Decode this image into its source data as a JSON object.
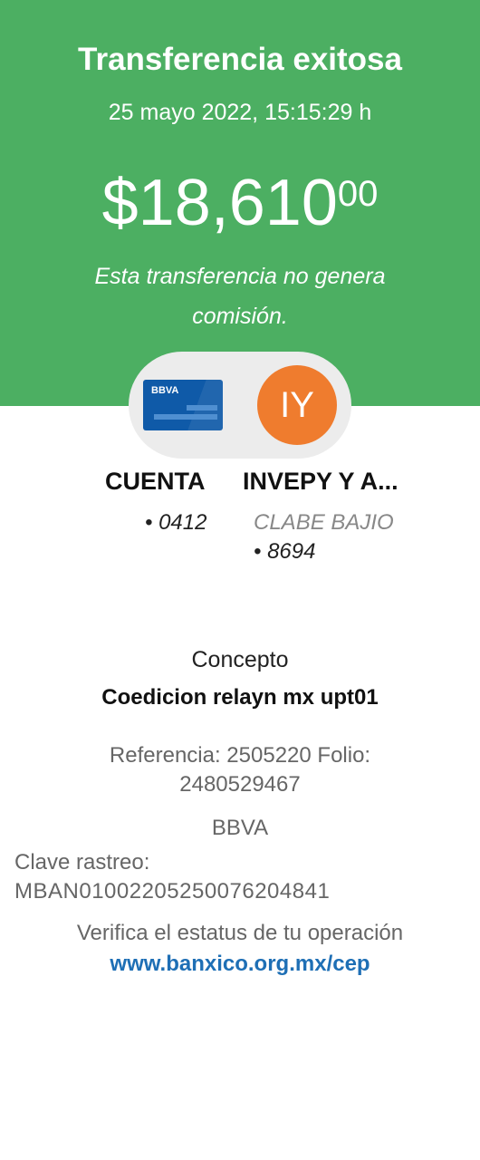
{
  "header": {
    "title": "Transferencia exitosa",
    "datetime": "25 mayo 2022, 15:15:29 h",
    "amount": {
      "whole": "$18,610",
      "cents": "00"
    },
    "note": "Esta transferencia no genera comisión."
  },
  "from": {
    "card_brand": "BBVA",
    "label": "CUENTA",
    "number": "• 0412"
  },
  "to": {
    "initials": "IY",
    "label": "INVEPY Y A...",
    "bank": "CLABE BAJIO",
    "number": "• 8694"
  },
  "details": {
    "concept_label": "Concepto",
    "concept_value": "Coedicion relayn mx upt01",
    "reference_line": "Referencia: 2505220   Folio: 2480529467",
    "bank": "BBVA",
    "tracking_label": "Clave rastreo:",
    "tracking_value": "MBAN01002205250076204841",
    "verify_text": "Verifica el estatus de tu operación",
    "link_text": "www.banxico.org.mx/cep"
  },
  "colors": {
    "header_green": "#4caf62",
    "avatar_orange": "#ef7c2e",
    "card_blue": "#0f5aa8",
    "link_blue": "#1e6fb5"
  },
  "icons": {
    "from": "bank-card-icon",
    "to": "initials-avatar"
  }
}
